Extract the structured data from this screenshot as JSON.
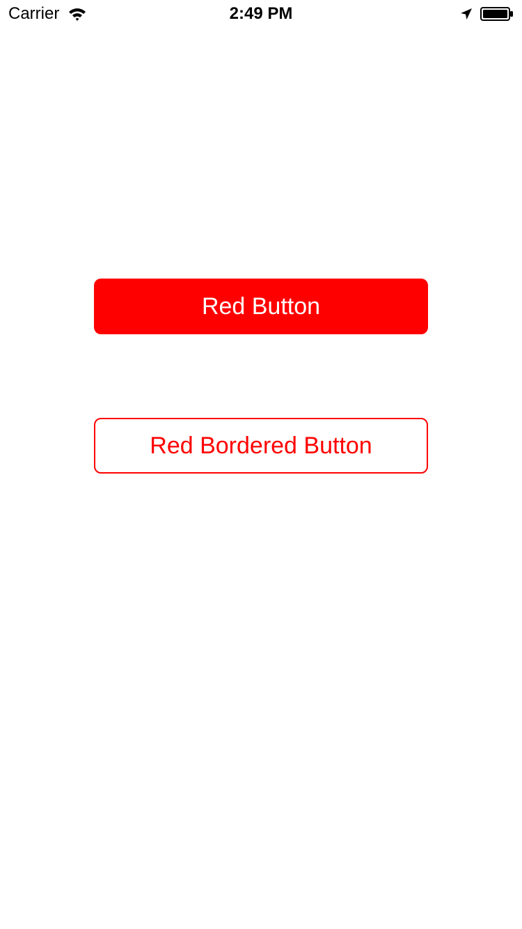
{
  "status_bar": {
    "carrier": "Carrier",
    "time": "2:49 PM",
    "icons": [
      "wifi-icon",
      "location-arrow-icon",
      "battery-icon"
    ]
  },
  "buttons": {
    "red_button_label": "Red Button",
    "red_bordered_button_label": "Red Bordered Button"
  },
  "colors": {
    "accent": "#ff0000",
    "background": "#ffffff",
    "filled_button_text": "#ffffff"
  }
}
